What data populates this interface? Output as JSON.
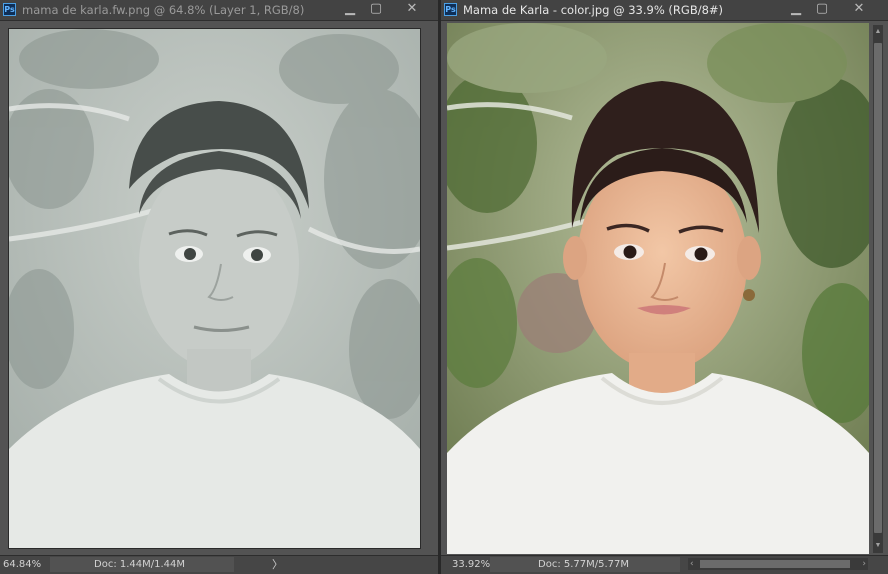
{
  "windows": [
    {
      "icon_text": "Ps",
      "title": "mama de karla.fw.png @ 64.8% (Layer 1, RGB/8)",
      "zoom": "64.84%",
      "doc": "Doc: 1.44M/1.44M",
      "arrow": "〉",
      "controls": {
        "minimize": "▁",
        "maximize": "▢",
        "close": "✕"
      }
    },
    {
      "icon_text": "Ps",
      "title": "Mama de Karla - color.jpg @ 33.9% (RGB/8#)",
      "zoom": "33.92%",
      "doc": "Doc: 5.77M/5.77M",
      "arrow": "〉",
      "controls": {
        "minimize": "▁",
        "maximize": "▢",
        "close": "✕"
      },
      "scroll": {
        "up": "▲",
        "down": "▼",
        "left": "‹",
        "right": "›"
      }
    }
  ],
  "colors": {
    "panel_bg": "#535353",
    "titlebar_bg": "#434343",
    "statusbar_bg": "#464646",
    "ps_icon_blue": "#61b4ff"
  }
}
